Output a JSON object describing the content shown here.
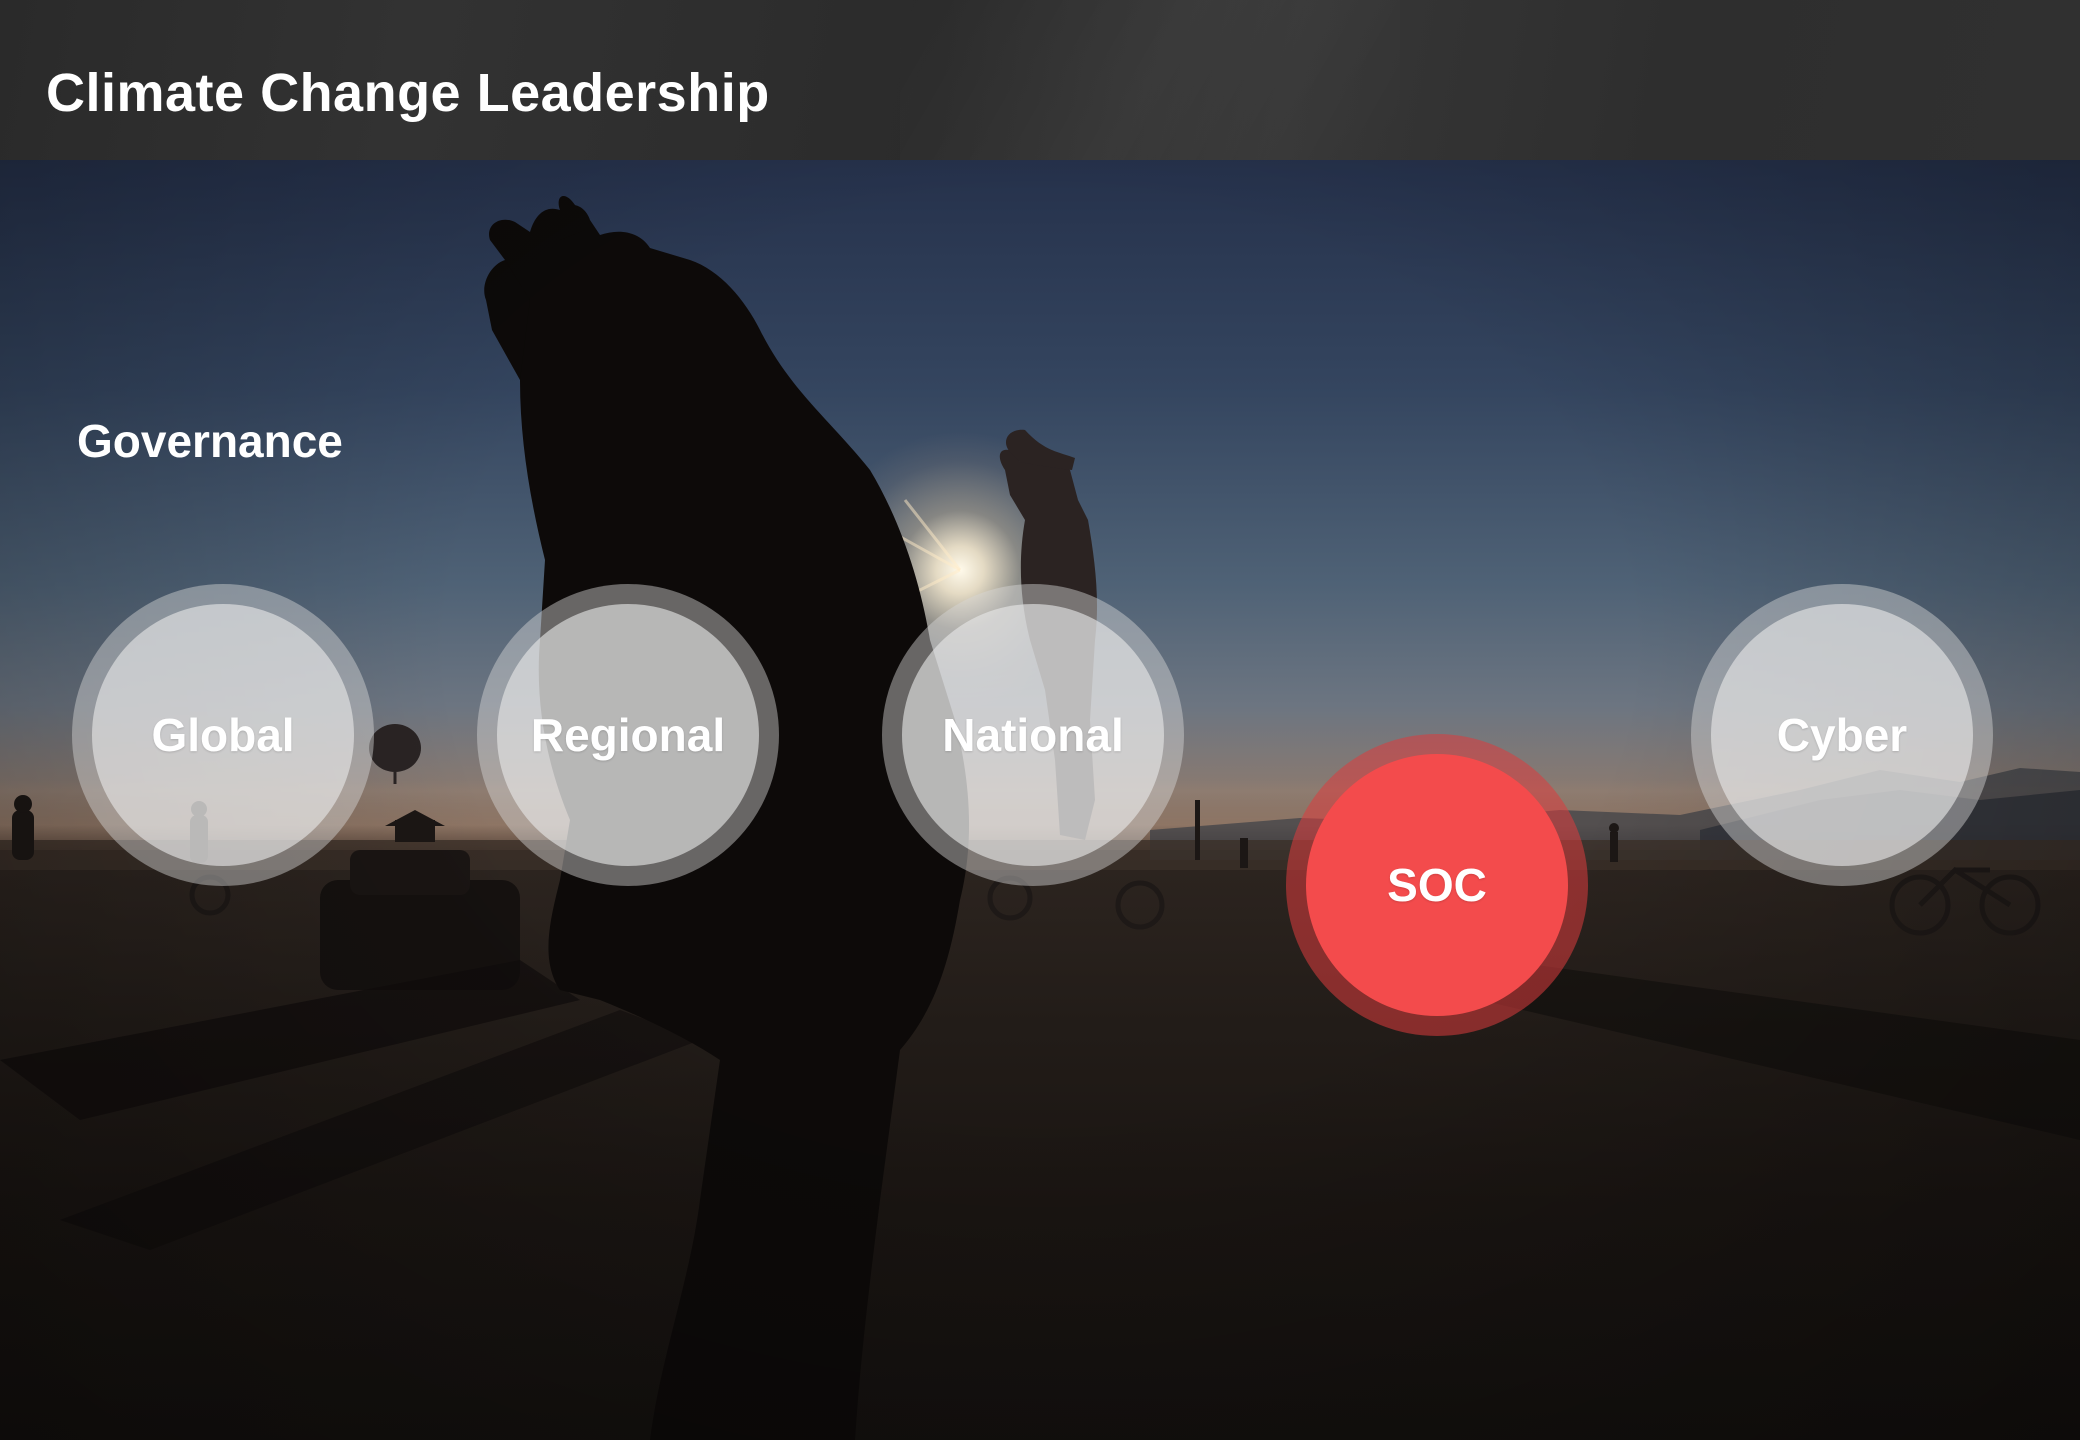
{
  "header": {
    "title": "Climate Change Leadership"
  },
  "section": {
    "heading": "Governance"
  },
  "nodes": [
    {
      "label": "Global",
      "state": "default"
    },
    {
      "label": "Regional",
      "state": "default"
    },
    {
      "label": "National",
      "state": "default"
    },
    {
      "label": "SOC",
      "state": "active"
    },
    {
      "label": "Cyber",
      "state": "default"
    }
  ],
  "colors": {
    "title_bar": "#2e2e2e",
    "active_node": "#f34b4c",
    "node_fill": "#e8e8e8",
    "text": "#ffffff"
  }
}
